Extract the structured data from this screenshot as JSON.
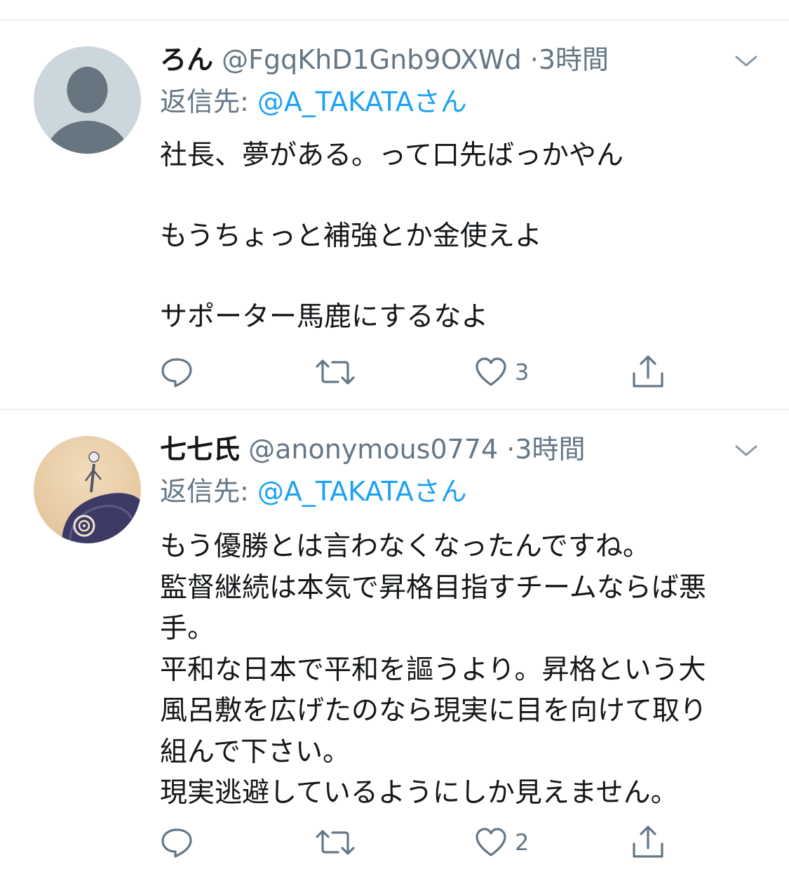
{
  "tweets": [
    {
      "display_name": "ろん",
      "handle": "@FgqKhD1Gnb9OXWd",
      "separator": "·",
      "time": "3時間",
      "reply_label": "返信先: ",
      "reply_target": "@A_TAKATAさん",
      "text": "社長、夢がある。って口先ばっかやん\n\nもうちょっと補強とか金使えよ\n\nサポーター馬鹿にするなよ",
      "like_count": "3",
      "avatar": "default-profile-avatar"
    },
    {
      "display_name": "七七氏",
      "handle": "@anonymous0774",
      "separator": "·",
      "time": "3時間",
      "reply_label": "返信先: ",
      "reply_target": "@A_TAKATAさん",
      "text": "もう優勝とは言わなくなったんですね。\n監督継続は本気で昇格目指すチームならば悪\n手。\n平和な日本で平和を謳うより。昇格という大\n風呂敷を広げたのなら現実に目を向けて取り\n組んで下さい。\n現実逃避しているようにしか見えません。",
      "like_count": "2",
      "avatar": "spiral-hill-figure-avatar"
    }
  ],
  "colors": {
    "text": "#14171a",
    "secondary": "#657786",
    "link": "#1da1f2",
    "divider": "#e1e8ed"
  },
  "icons": [
    "reply-icon",
    "retweet-icon",
    "like-icon",
    "share-icon",
    "chevron-down-icon"
  ]
}
